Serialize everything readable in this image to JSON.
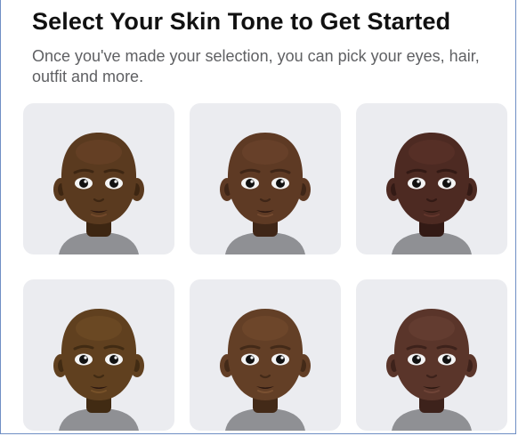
{
  "header": {
    "title": "Select Your Skin Tone to Get Started",
    "subtitle": "Once you've made your selection, you can pick your eyes, hair, outfit and more."
  },
  "skin_tones": [
    {
      "color": "#5a3a1f",
      "shade": "#3d2612",
      "highlight": "#71482a"
    },
    {
      "color": "#5e3a24",
      "shade": "#3f2617",
      "highlight": "#744a30"
    },
    {
      "color": "#4d2a22",
      "shade": "#331a15",
      "highlight": "#62362c"
    },
    {
      "color": "#60401f",
      "shade": "#412b13",
      "highlight": "#775129"
    },
    {
      "color": "#633f26",
      "shade": "#432a18",
      "highlight": "#7a5031"
    },
    {
      "color": "#5a352a",
      "shade": "#3d221b",
      "highlight": "#6f4437"
    }
  ],
  "colors": {
    "tile_bg": "#ebecf0",
    "shirt": "#8f9094",
    "eye_white": "#f4f4f4",
    "pupil": "#111111",
    "mouth": "#2b1710"
  }
}
